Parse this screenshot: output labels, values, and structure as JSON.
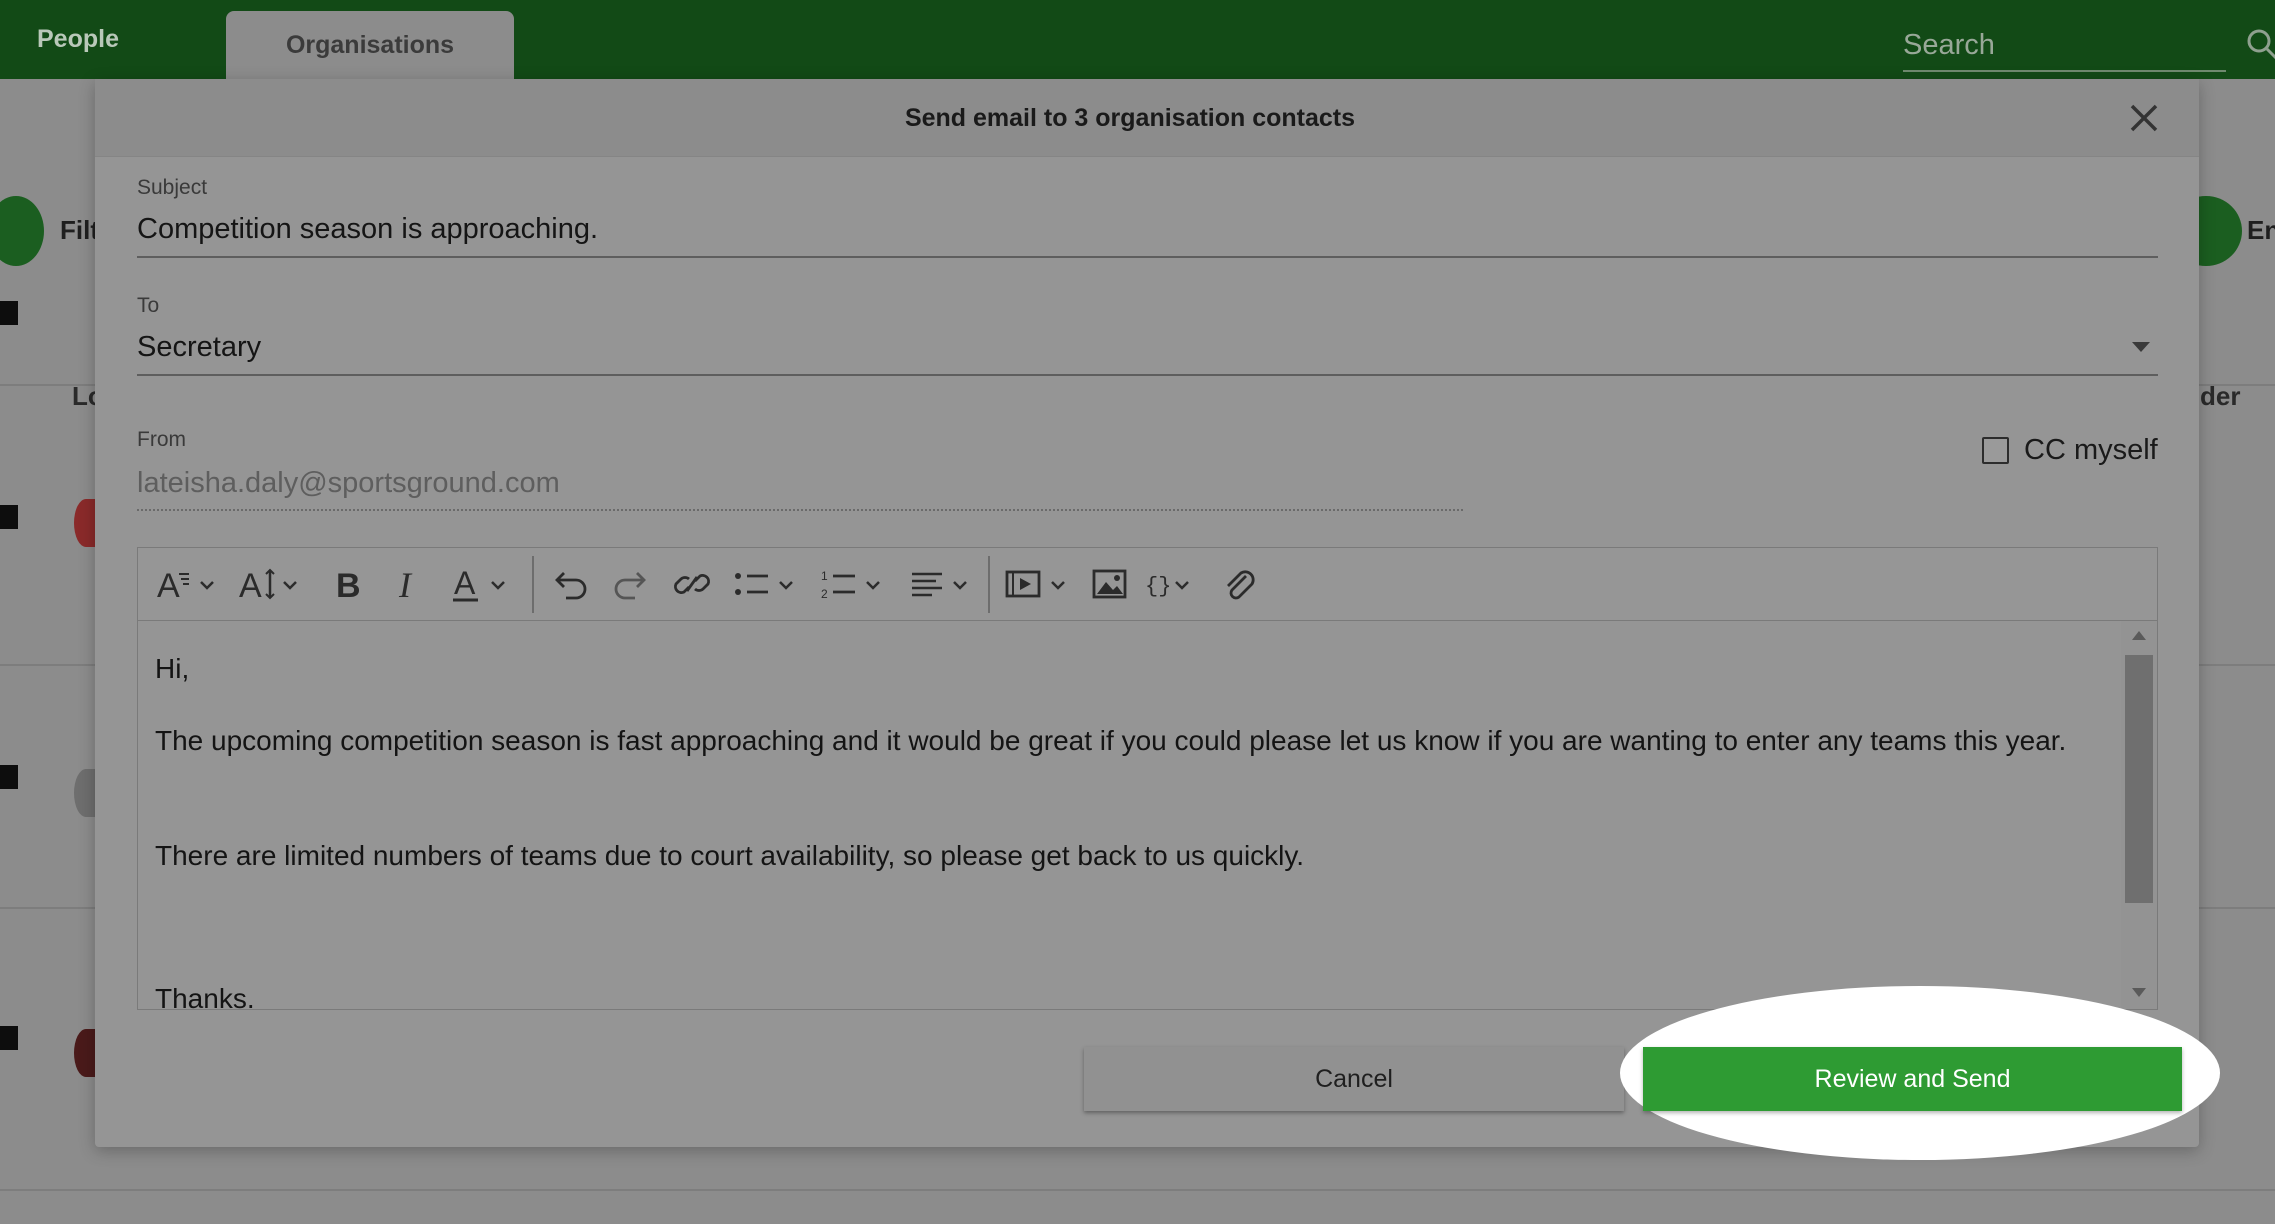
{
  "topbar": {
    "tabs": [
      {
        "label": "People"
      },
      {
        "label": "Organisations"
      }
    ],
    "search_placeholder": "Search"
  },
  "background": {
    "filter_label": "Filt",
    "column_left": "Lo",
    "column_right": "der",
    "right_action_label": "En"
  },
  "modal": {
    "title": "Send email to 3 organisation contacts",
    "subject": {
      "label": "Subject",
      "value": "Competition season is approaching."
    },
    "to": {
      "label": "To",
      "value": "Secretary"
    },
    "from": {
      "label": "From",
      "value": "lateisha.daly@sportsground.com"
    },
    "cc_myself": {
      "label": "CC myself",
      "checked": false
    },
    "toolbar_icons": [
      "font-family-icon",
      "font-size-icon",
      "bold-icon",
      "italic-icon",
      "font-color-icon",
      "undo-icon",
      "redo-icon",
      "link-icon",
      "bulleted-list-icon",
      "numbered-list-icon",
      "align-icon",
      "media-icon",
      "image-icon",
      "code-icon",
      "attachment-icon"
    ],
    "body": {
      "p1": "Hi,",
      "p2": "The upcoming competition season is fast approaching and it would be great if you could please let us know if you are wanting to enter any teams this year.",
      "p3": "There are limited numbers of teams due to court availability, so please get back to us quickly.",
      "p4": "Thanks."
    },
    "buttons": {
      "cancel": "Cancel",
      "review_send": "Review and Send"
    }
  },
  "colors": {
    "topbar": "#124a16",
    "primary_button": "#2e9b33"
  }
}
